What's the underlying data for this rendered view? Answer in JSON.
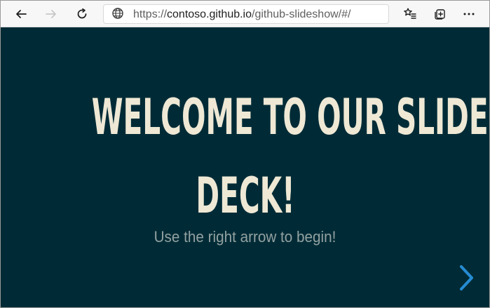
{
  "browser": {
    "url_scheme": "https://",
    "url_host": "contoso.github.io",
    "url_path": "/github-slideshow/#/",
    "toolbar_icons": [
      "back-icon",
      "forward-icon",
      "refresh-icon",
      "globe-icon",
      "favorites-icon",
      "collections-icon",
      "more-icon"
    ]
  },
  "slide": {
    "title_line1": "WELCOME TO OUR SLIDE",
    "title_line2": "DECK!",
    "subtitle": "Use the right arrow to begin!",
    "background_color": "#002b36",
    "title_color": "#eee8d5",
    "subtitle_color": "#93a1a1",
    "navigation_icon": "chevron-right-icon",
    "navigation_color": "#268bd2"
  }
}
